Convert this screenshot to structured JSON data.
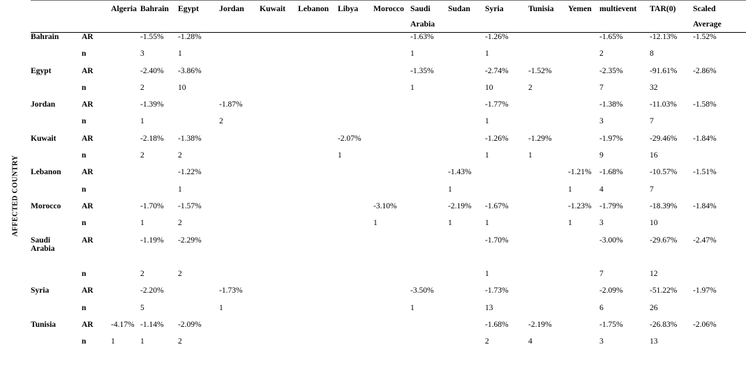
{
  "axis_caption": "AFFECTED COUNTRY",
  "columns": [
    {
      "key": "country",
      "label": ""
    },
    {
      "key": "metric",
      "label": ""
    },
    {
      "key": "algeria",
      "label": "Algeria"
    },
    {
      "key": "bahrain",
      "label": "Bahrain"
    },
    {
      "key": "egypt",
      "label": "Egypt"
    },
    {
      "key": "jordan",
      "label": "Jordan"
    },
    {
      "key": "kuwait",
      "label": "Kuwait"
    },
    {
      "key": "lebanon",
      "label": "Lebanon"
    },
    {
      "key": "libya",
      "label": "Libya"
    },
    {
      "key": "morocco",
      "label": "Morocco"
    },
    {
      "key": "saudi",
      "label": "Saudi",
      "label2": "Arabia"
    },
    {
      "key": "sudan",
      "label": "Sudan"
    },
    {
      "key": "syria",
      "label": "Syria"
    },
    {
      "key": "tunisia",
      "label": "Tunisia"
    },
    {
      "key": "yemen",
      "label": "Yemen"
    },
    {
      "key": "multi",
      "label": "multievent"
    },
    {
      "key": "tar",
      "label": "TAR(0)"
    },
    {
      "key": "scaled",
      "label": "Scaled",
      "label2": "Average"
    }
  ],
  "chart_data": {
    "type": "table",
    "title": "",
    "row_header_label": "AFFECTED COUNTRY",
    "metrics": [
      "AR",
      "n"
    ],
    "categories": [
      "Algeria",
      "Bahrain",
      "Egypt",
      "Jordan",
      "Kuwait",
      "Lebanon",
      "Libya",
      "Morocco",
      "Saudi Arabia",
      "Sudan",
      "Syria",
      "Tunisia",
      "Yemen",
      "multievent",
      "TAR(0)",
      "Scaled Average"
    ],
    "rows": [
      {
        "country": "Bahrain",
        "AR": {
          "algeria": "",
          "bahrain": "-1.55%",
          "egypt": "-1.28%",
          "jordan": "",
          "kuwait": "",
          "lebanon": "",
          "libya": "",
          "morocco": "",
          "saudi": "-1.63%",
          "sudan": "",
          "syria": "-1.26%",
          "tunisia": "",
          "yemen": "",
          "multi": "-1.65%",
          "tar": "-12.13%",
          "scaled": "-1.52%"
        },
        "n": {
          "algeria": "",
          "bahrain": "3",
          "egypt": "1",
          "jordan": "",
          "kuwait": "",
          "lebanon": "",
          "libya": "",
          "morocco": "",
          "saudi": "1",
          "sudan": "",
          "syria": "1",
          "tunisia": "",
          "yemen": "",
          "multi": "2",
          "tar": "8",
          "scaled": ""
        }
      },
      {
        "country": "Egypt",
        "AR": {
          "algeria": "",
          "bahrain": "-2.40%",
          "egypt": "-3.86%",
          "jordan": "",
          "kuwait": "",
          "lebanon": "",
          "libya": "",
          "morocco": "",
          "saudi": "-1.35%",
          "sudan": "",
          "syria": "-2.74%",
          "tunisia": "-1.52%",
          "yemen": "",
          "multi": "-2.35%",
          "tar": "-91.61%",
          "scaled": "-2.86%"
        },
        "n": {
          "algeria": "",
          "bahrain": "2",
          "egypt": "10",
          "jordan": "",
          "kuwait": "",
          "lebanon": "",
          "libya": "",
          "morocco": "",
          "saudi": "1",
          "sudan": "",
          "syria": "10",
          "tunisia": "2",
          "yemen": "",
          "multi": "7",
          "tar": "32",
          "scaled": ""
        }
      },
      {
        "country": "Jordan",
        "AR": {
          "algeria": "",
          "bahrain": "-1.39%",
          "egypt": "",
          "jordan": "-1.87%",
          "kuwait": "",
          "lebanon": "",
          "libya": "",
          "morocco": "",
          "saudi": "",
          "sudan": "",
          "syria": "-1.77%",
          "tunisia": "",
          "yemen": "",
          "multi": "-1.38%",
          "tar": "-11.03%",
          "scaled": "-1.58%"
        },
        "n": {
          "algeria": "",
          "bahrain": "1",
          "egypt": "",
          "jordan": "2",
          "kuwait": "",
          "lebanon": "",
          "libya": "",
          "morocco": "",
          "saudi": "",
          "sudan": "",
          "syria": "1",
          "tunisia": "",
          "yemen": "",
          "multi": "3",
          "tar": "7",
          "scaled": ""
        }
      },
      {
        "country": "Kuwait",
        "AR": {
          "algeria": "",
          "bahrain": "-2.18%",
          "egypt": "-1.38%",
          "jordan": "",
          "kuwait": "",
          "lebanon": "",
          "libya": "-2.07%",
          "morocco": "",
          "saudi": "",
          "sudan": "",
          "syria": "-1.26%",
          "tunisia": "-1.29%",
          "yemen": "",
          "multi": "-1.97%",
          "tar": "-29.46%",
          "scaled": "-1.84%"
        },
        "n": {
          "algeria": "",
          "bahrain": "2",
          "egypt": "2",
          "jordan": "",
          "kuwait": "",
          "lebanon": "",
          "libya": "1",
          "morocco": "",
          "saudi": "",
          "sudan": "",
          "syria": "1",
          "tunisia": "1",
          "yemen": "",
          "multi": "9",
          "tar": "16",
          "scaled": ""
        }
      },
      {
        "country": "Lebanon",
        "AR": {
          "algeria": "",
          "bahrain": "",
          "egypt": "-1.22%",
          "jordan": "",
          "kuwait": "",
          "lebanon": "",
          "libya": "",
          "morocco": "",
          "saudi": "",
          "sudan": "-1.43%",
          "syria": "",
          "tunisia": "",
          "yemen": "-1.21%",
          "multi": "-1.68%",
          "tar": "-10.57%",
          "scaled": "-1.51%"
        },
        "n": {
          "algeria": "",
          "bahrain": "",
          "egypt": "1",
          "jordan": "",
          "kuwait": "",
          "lebanon": "",
          "libya": "",
          "morocco": "",
          "saudi": "",
          "sudan": "1",
          "syria": "",
          "tunisia": "",
          "yemen": "1",
          "multi": "4",
          "tar": "7",
          "scaled": ""
        }
      },
      {
        "country": "Morocco",
        "AR": {
          "algeria": "",
          "bahrain": "-1.70%",
          "egypt": "-1.57%",
          "jordan": "",
          "kuwait": "",
          "lebanon": "",
          "libya": "",
          "morocco": "-3.10%",
          "saudi": "",
          "sudan": "-2.19%",
          "syria": "-1.67%",
          "tunisia": "",
          "yemen": "-1.23%",
          "multi": "-1.79%",
          "tar": "-18.39%",
          "scaled": "-1.84%"
        },
        "n": {
          "algeria": "",
          "bahrain": "1",
          "egypt": "2",
          "jordan": "",
          "kuwait": "",
          "lebanon": "",
          "libya": "",
          "morocco": "1",
          "saudi": "",
          "sudan": "1",
          "syria": "1",
          "tunisia": "",
          "yemen": "1",
          "multi": "3",
          "tar": "10",
          "scaled": ""
        }
      },
      {
        "country": "Saudi",
        "country_line2": "Arabia",
        "AR": {
          "algeria": "",
          "bahrain": "-1.19%",
          "egypt": "-2.29%",
          "jordan": "",
          "kuwait": "",
          "lebanon": "",
          "libya": "",
          "morocco": "",
          "saudi": "",
          "sudan": "",
          "syria": "-1.70%",
          "tunisia": "",
          "yemen": "",
          "multi": "-3.00%",
          "tar": "-29.67%",
          "scaled": "-2.47%"
        },
        "n": {
          "algeria": "",
          "bahrain": "2",
          "egypt": "2",
          "jordan": "",
          "kuwait": "",
          "lebanon": "",
          "libya": "",
          "morocco": "",
          "saudi": "",
          "sudan": "",
          "syria": "1",
          "tunisia": "",
          "yemen": "",
          "multi": "7",
          "tar": "12",
          "scaled": ""
        }
      },
      {
        "country": "Syria",
        "AR": {
          "algeria": "",
          "bahrain": "-2.20%",
          "egypt": "",
          "jordan": "-1.73%",
          "kuwait": "",
          "lebanon": "",
          "libya": "",
          "morocco": "",
          "saudi": "-3.50%",
          "sudan": "",
          "syria": "-1.73%",
          "tunisia": "",
          "yemen": "",
          "multi": "-2.09%",
          "tar": "-51.22%",
          "scaled": "-1.97%"
        },
        "n": {
          "algeria": "",
          "bahrain": "5",
          "egypt": "",
          "jordan": "1",
          "kuwait": "",
          "lebanon": "",
          "libya": "",
          "morocco": "",
          "saudi": "1",
          "sudan": "",
          "syria": "13",
          "tunisia": "",
          "yemen": "",
          "multi": "6",
          "tar": "26",
          "scaled": ""
        }
      },
      {
        "country": "Tunisia",
        "AR": {
          "algeria": "-4.17%",
          "bahrain": "-1.14%",
          "egypt": "-2.09%",
          "jordan": "",
          "kuwait": "",
          "lebanon": "",
          "libya": "",
          "morocco": "",
          "saudi": "",
          "sudan": "",
          "syria": "-1.68%",
          "tunisia": "-2.19%",
          "yemen": "",
          "multi": "-1.75%",
          "tar": "-26.83%",
          "scaled": "-2.06%"
        },
        "n": {
          "algeria": "1",
          "bahrain": "1",
          "egypt": "2",
          "jordan": "",
          "kuwait": "",
          "lebanon": "",
          "libya": "",
          "morocco": "",
          "saudi": "",
          "sudan": "",
          "syria": "2",
          "tunisia": "4",
          "yemen": "",
          "multi": "3",
          "tar": "13",
          "scaled": ""
        }
      }
    ]
  }
}
